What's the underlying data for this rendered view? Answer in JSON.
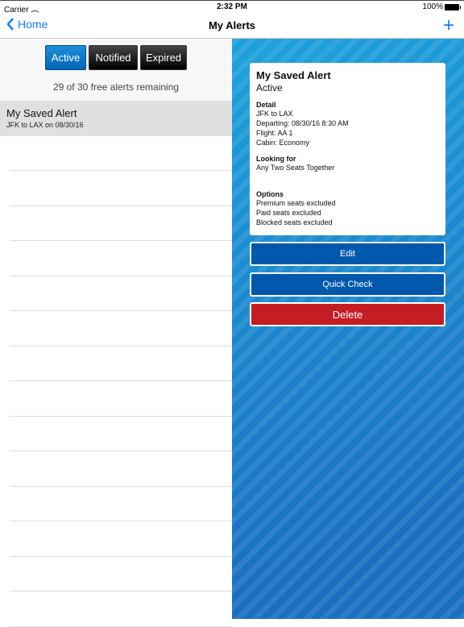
{
  "status": {
    "carrier": "Carrier",
    "time": "2:32 PM",
    "battery": "100%"
  },
  "nav": {
    "back_label": "Home",
    "title": "My Alerts",
    "add_icon": "plus-icon"
  },
  "segments": [
    {
      "label": "Active",
      "selected": true
    },
    {
      "label": "Notified",
      "selected": false
    },
    {
      "label": "Expired",
      "selected": false
    }
  ],
  "remaining": "29 of 30 free alerts remaining",
  "alerts": [
    {
      "title": "My Saved Alert",
      "subtitle": "JFK to LAX on 08/30/16"
    }
  ],
  "detail": {
    "title": "My Saved Alert",
    "status": "Active",
    "detail_label": "Detail",
    "detail_lines": [
      "JFK to LAX",
      "Departing: 08/30/16 8:30 AM",
      "Flight: AA 1",
      "Cabin: Economy"
    ],
    "looking_label": "Looking for",
    "looking_value": "Any Two Seats Together",
    "options_label": "Options",
    "options_lines": [
      "Premium seats excluded",
      "Paid seats excluded",
      "Blocked seats excluded"
    ]
  },
  "buttons": {
    "edit": "Edit",
    "quick_check": "Quick Check",
    "delete": "Delete"
  },
  "colors": {
    "accent": "#157efb",
    "button_blue": "#0258ad",
    "button_red": "#c41d24"
  }
}
